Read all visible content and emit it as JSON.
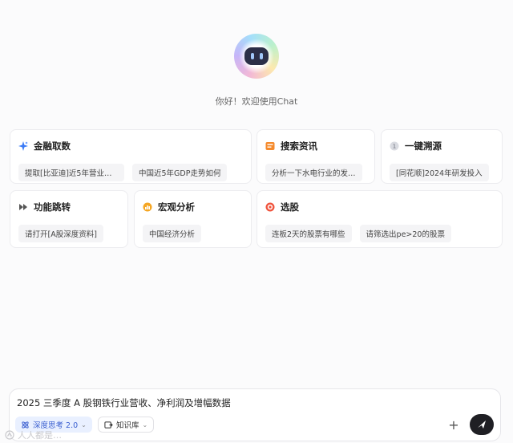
{
  "greeting": "你好！欢迎使用Chat",
  "cards": {
    "finance": {
      "title": "金融取数",
      "chips": [
        "提取[比亚迪]近5年营业…",
        "中国近5年GDP走势如何"
      ]
    },
    "news": {
      "title": "搜索资讯",
      "chips": [
        "分析一下水电行业的发…"
      ]
    },
    "trace": {
      "title": "一键溯源",
      "chips": [
        "[同花顺]2024年研发投入"
      ]
    },
    "jump": {
      "title": "功能跳转",
      "chips": [
        "请打开[A股深度资料]"
      ]
    },
    "macro": {
      "title": "宏观分析",
      "chips": [
        "中国经济分析"
      ]
    },
    "stock": {
      "title": "选股",
      "chips": [
        "连板2天的股票有哪些",
        "请筛选出pe>20的股票"
      ]
    }
  },
  "input": {
    "value": "2025 三季度 A 股钢铁行业营收、净利润及增幅数据",
    "deep_think_label": "深度思考 2.0",
    "knowledge_label": "知识库",
    "plus_label": "+"
  },
  "watermark": "人人都是…",
  "colors": {
    "deep_bg": "#e9f0ff",
    "deep_text": "#3a5fd0",
    "send_bg": "#1f1f24"
  }
}
